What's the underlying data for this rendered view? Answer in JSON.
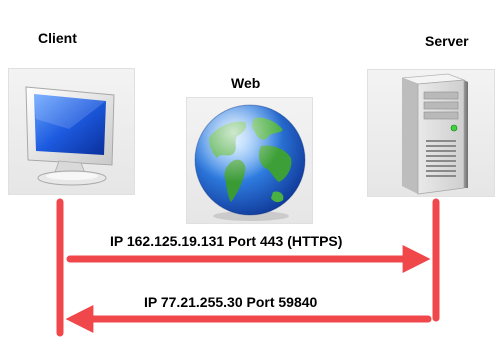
{
  "nodes": {
    "client": {
      "label": "Client",
      "icon": "computer-monitor-icon"
    },
    "web": {
      "label": "Web",
      "icon": "globe-icon"
    },
    "server": {
      "label": "Server",
      "icon": "server-tower-icon"
    }
  },
  "connections": {
    "request": {
      "label": "IP 162.125.19.131 Port 443 (HTTPS)",
      "direction": "client-to-server"
    },
    "response": {
      "label": "IP 77.21.255.30 Port 59840",
      "direction": "server-to-client"
    }
  },
  "colors": {
    "arrow": "#f0474b",
    "text": "#000000",
    "tile_bg": "#ececec"
  }
}
